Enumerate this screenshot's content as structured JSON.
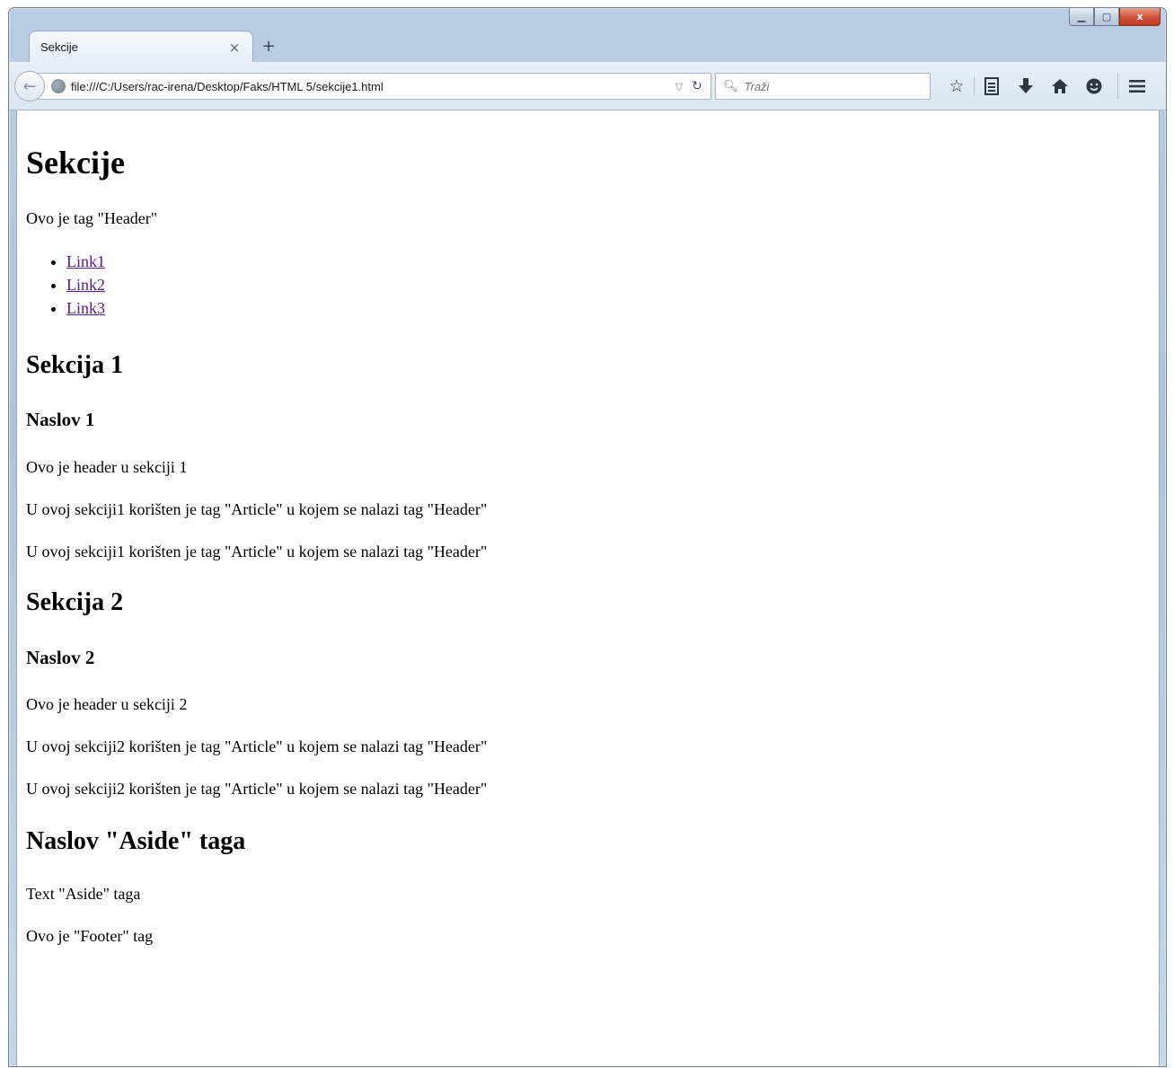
{
  "browser": {
    "tab_title": "Sekcije",
    "tab_close": "×",
    "new_tab": "+",
    "url": "file:///C:/Users/rac-irena/Desktop/Faks/HTML 5/sekcije1.html",
    "search_placeholder": "Traži",
    "window_controls": {
      "minimize": "▁",
      "maximize": "▢",
      "close": "x"
    },
    "toolbar_icons": [
      "star-icon",
      "reading-list-icon",
      "download-icon",
      "home-icon",
      "hello-icon",
      "menu-icon"
    ]
  },
  "page": {
    "title": "Sekcije",
    "header_text": "Ovo je tag \"Header\"",
    "nav_links": [
      "Link1",
      "Link2",
      "Link3"
    ],
    "section1": {
      "heading": "Sekcija 1",
      "subheading": "Naslov 1",
      "header_text": "Ovo je header u sekciji 1",
      "paragraphs": [
        "U ovoj sekciji1 korišten je tag \"Article\" u kojem se nalazi tag \"Header\"",
        "U ovoj sekciji1 korišten je tag \"Article\" u kojem se nalazi tag \"Header\""
      ]
    },
    "section2": {
      "heading": "Sekcija 2",
      "subheading": "Naslov 2",
      "header_text": "Ovo je header u sekciji 2",
      "paragraphs": [
        "U ovoj sekciji2 korišten je tag \"Article\" u kojem se nalazi tag \"Header\"",
        "U ovoj sekciji2 korišten je tag \"Article\" u kojem se nalazi tag \"Header\""
      ]
    },
    "aside": {
      "heading": "Naslov \"Aside\" taga",
      "text": "Text \"Aside\" taga"
    },
    "footer_text": "Ovo je \"Footer\" tag"
  }
}
